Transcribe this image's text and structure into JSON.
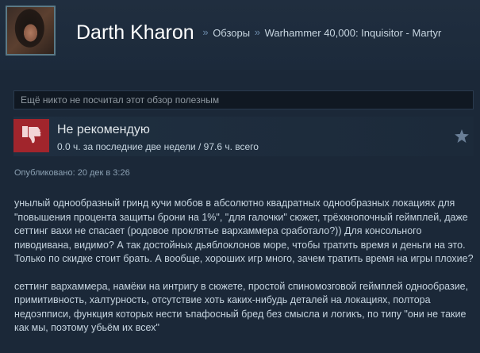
{
  "header": {
    "persona_name": "Darth Kharon",
    "separator": "»",
    "breadcrumb_reviews": "Обзоры",
    "breadcrumb_game": "Warhammer 40,000: Inquisitor - Martyr"
  },
  "helpful_text": "Ещё никто не посчитал этот обзор полезным",
  "review": {
    "verdict": "Не рекомендую",
    "hours": "0.0 ч. за последние две недели / 97.6 ч. всего",
    "posted": "Опубликовано: 20 дек в 3:26",
    "paragraph_1": "унылый однообразный гринд кучи мобов в абсолютно квадратных однообразных локациях для \"повышения процента защиты брони на 1%\", \"для галочки\" сюжет, трёхкнопочный геймплей, даже сеттинг вахи не спасает (родовое проклятье вархаммера сработало?)) Для консольного пиводивана, видимо? А так достойных дьяблоклонов море, чтобы тратить время и деньги на это. Только по скидке стоит брать. А вообще, хороших игр много, зачем тратить время на игры плохие?",
    "paragraph_2": "сеттинг вархаммера, намёки на интригу в сюжете, простой спиномозговой геймплей однообразие, примитивность, халтурность, отсутствие хоть каких-нибудь деталей на локациях, полтора недоэпписи, функция которых нести ъпафосный бред без смысла и логикъ, по типу \"они не такие как мы, поэтому убьём их всех\""
  },
  "icons": {
    "thumb": "thumbs-down-icon",
    "star": "star-icon"
  },
  "colors": {
    "background": "#1b2838",
    "thumb_bg": "#a1252c",
    "text": "#c6d4df"
  }
}
